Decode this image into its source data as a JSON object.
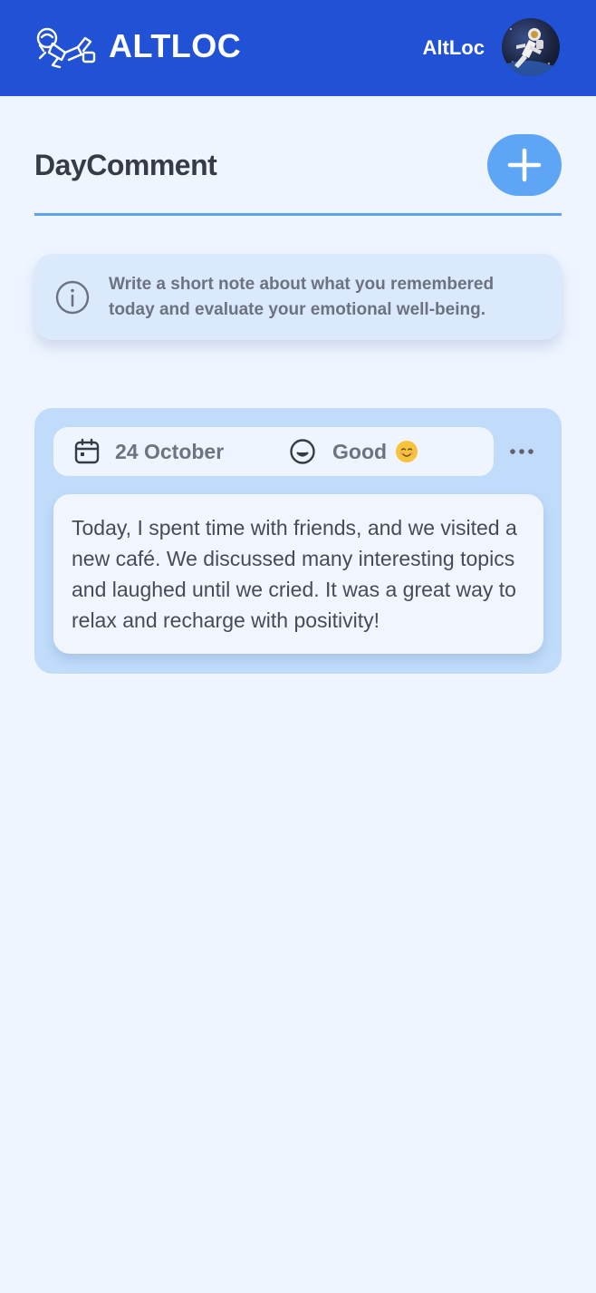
{
  "header": {
    "brand": "ALTLOC",
    "username": "AltLoc"
  },
  "page": {
    "title": "DayComment"
  },
  "info": {
    "text": "Write a short note about what you remembered today and evaluate your emotional well-being."
  },
  "entry": {
    "date": "24 October",
    "mood": "Good",
    "note": "Today, I spent time with friends, and we visited a new café. We discussed many interesting topics and laughed until we cried. It was a great way to relax and recharge with positivity!"
  },
  "icons": {
    "logo": "astronaut-logo-icon",
    "avatar": "astronaut-photo",
    "add": "plus-icon",
    "info": "info-circle-icon",
    "date": "calendar-icon",
    "mood": "smile-icon",
    "emoji": "smiling-face-emoji",
    "more": "more-horizontal-icon"
  },
  "colors": {
    "header": "#2152d6",
    "background": "#eef5ff",
    "accent": "#5ea6f5",
    "card": "#c0dcfa"
  }
}
